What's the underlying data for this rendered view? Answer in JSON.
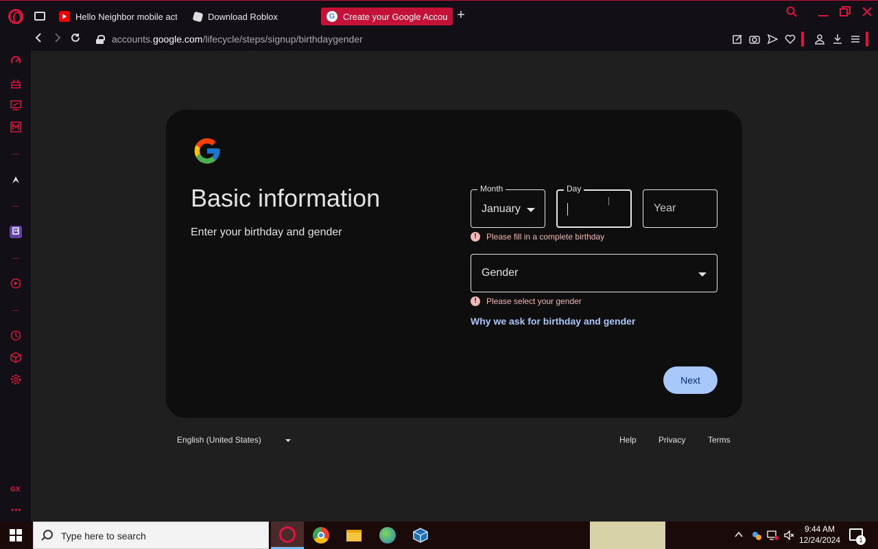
{
  "tabs": [
    {
      "label": "Hello Neighbor mobile act",
      "icon": "youtube-icon"
    },
    {
      "label": "Download Roblox",
      "icon": "roblox-icon"
    },
    {
      "label": "Create your Google Accou",
      "icon": "google-icon"
    }
  ],
  "addressbar": {
    "url_prefix": "accounts.",
    "url_domain": "google.com",
    "url_path": "/lifecycle/steps/signup/birthdaygender"
  },
  "page": {
    "title": "Basic information",
    "subtitle": "Enter your birthday and gender",
    "month_label": "Month",
    "month_value": "January",
    "day_label": "Day",
    "day_value": "",
    "year_placeholder": "Year",
    "birthday_error": "Please fill in a complete birthday",
    "gender_placeholder": "Gender",
    "gender_error": "Please select your gender",
    "why_link": "Why we ask for birthday and gender",
    "next_label": "Next",
    "error_icon_glyph": "!"
  },
  "footer": {
    "language": "English (United States)",
    "help": "Help",
    "privacy": "Privacy",
    "terms": "Terms"
  },
  "taskbar": {
    "search_placeholder": "Type here to search",
    "time": "9:44 AM",
    "date": "12/24/2024",
    "notification_count": "1"
  },
  "colors": {
    "accent": "#e0153f",
    "error": "#f2b8b5",
    "link": "#a8c7fa",
    "button": "#a8c7fa"
  }
}
